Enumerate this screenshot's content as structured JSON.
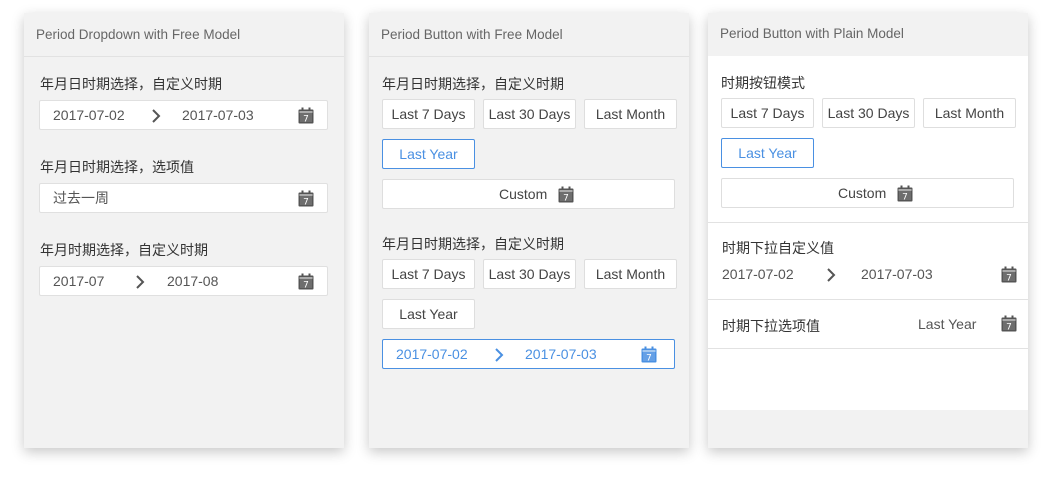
{
  "colors": {
    "accent": "#4a90e2",
    "panel_bg": "#f2f2f2",
    "border": "#e0e0e0"
  },
  "panel1": {
    "title": "Period Dropdown with Free Model",
    "s1_label": "年月日时期选择，自定义时期",
    "s1_start": "2017-07-02",
    "s1_end": "2017-07-03",
    "s2_label": "年月日时期选择，选项值",
    "s2_value": "过去一周",
    "s3_label": "年月时期选择，自定义时期",
    "s3_start": "2017-07",
    "s3_end": "2017-08"
  },
  "panel2": {
    "title": "Period Button with Free Model",
    "g1_label": "年月日时期选择，自定义时期",
    "g1_buttons": [
      "Last 7 Days",
      "Last 30 Days",
      "Last Month",
      "Last Year"
    ],
    "custom_label": "Custom",
    "g2_label": "年月日时期选择，自定义时期",
    "g2_buttons": [
      "Last 7 Days",
      "Last 30 Days",
      "Last Month",
      "Last Year"
    ],
    "g2_start": "2017-07-02",
    "g2_end": "2017-07-03"
  },
  "panel3": {
    "title": "Period Button with Plain Model",
    "s1_label": "时期按钮模式",
    "buttons": [
      "Last 7 Days",
      "Last 30 Days",
      "Last Month",
      "Last Year"
    ],
    "custom_label": "Custom",
    "s2_label": "时期下拉自定义值",
    "s2_start": "2017-07-02",
    "s2_end": "2017-07-03",
    "s3_label": "时期下拉选项值",
    "s3_value": "Last Year"
  },
  "calendar_day": "7"
}
